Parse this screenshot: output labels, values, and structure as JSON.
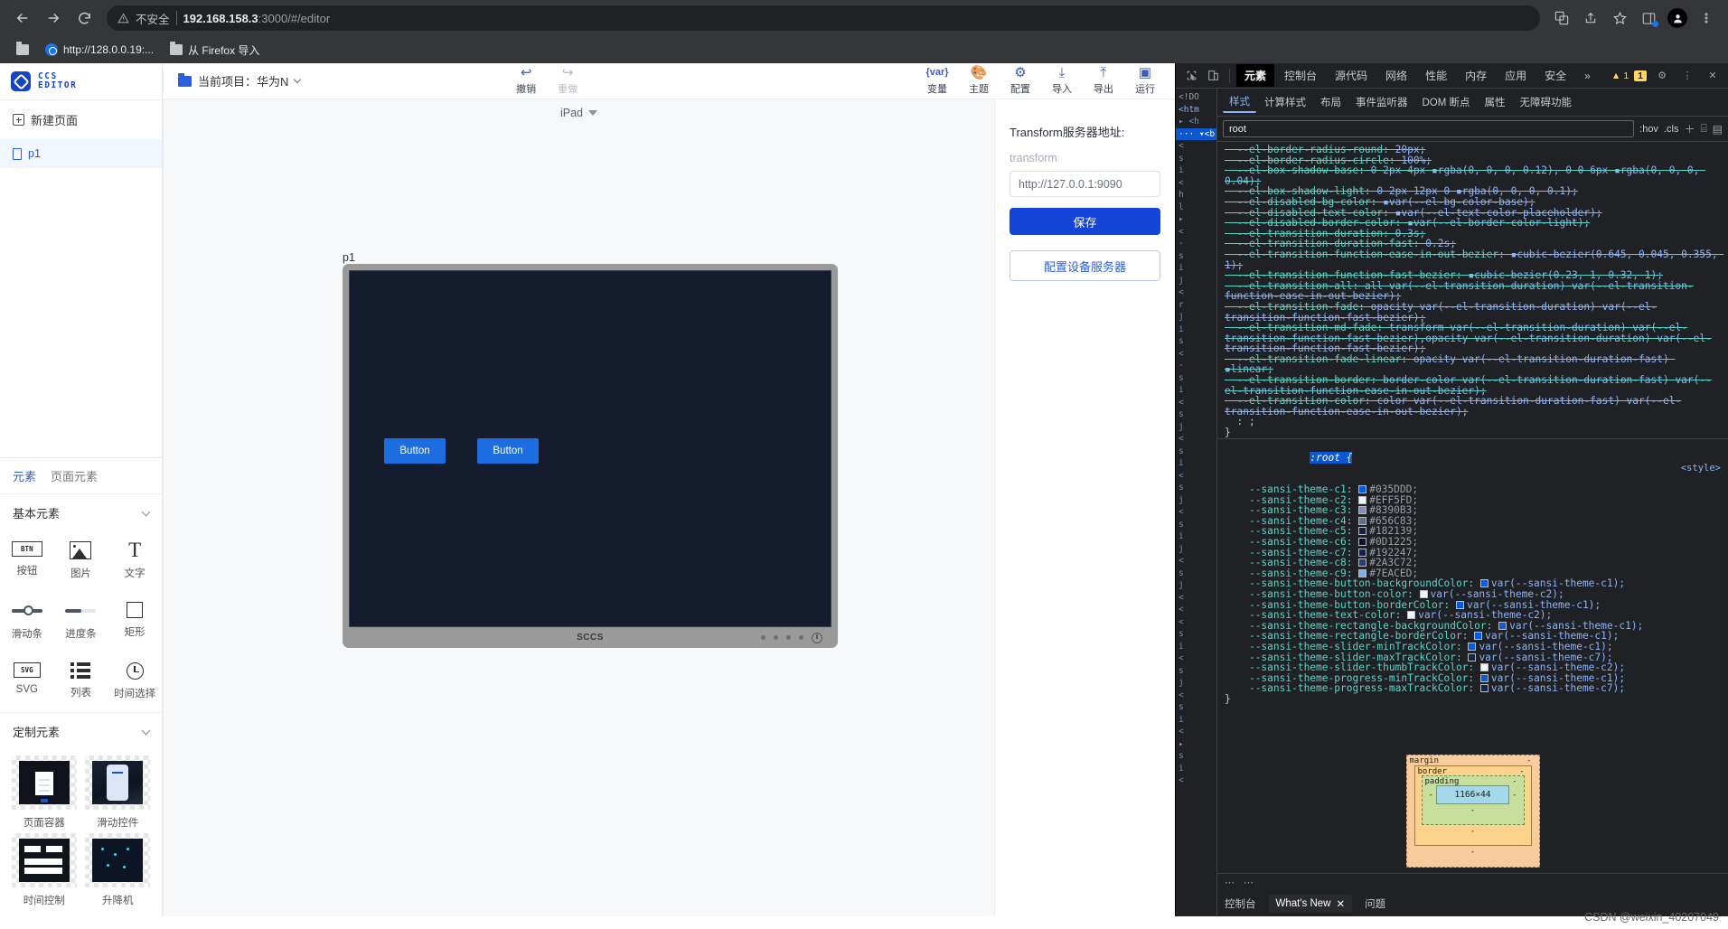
{
  "browser": {
    "security_label": "不安全",
    "url_host": "192.168.158.3",
    "url_path": ":3000/#/editor",
    "bookmarks": [
      {
        "label": "http://128.0.0.19:...",
        "icon": "globe-icon"
      },
      {
        "label": "从 Firefox 导入",
        "icon": "folder-icon"
      }
    ],
    "icons": [
      "translate-icon",
      "share-icon",
      "bookmark-star-icon",
      "side-panel-icon",
      "profile-avatar-icon",
      "more-menu-icon"
    ]
  },
  "app": {
    "logo_line1": "CCS",
    "logo_line2": "EDITOR",
    "project_label": "当前项目：华为N",
    "new_page": "新建页面",
    "pages": [
      {
        "name": "p1"
      }
    ],
    "toolbar": [
      {
        "label": "撤销",
        "icon": "undo-icon",
        "enabled": true
      },
      {
        "label": "重做",
        "icon": "redo-icon",
        "enabled": false
      },
      {
        "label": "变量",
        "icon": "var-icon",
        "enabled": true
      },
      {
        "label": "主题",
        "icon": "palette-icon",
        "enabled": true
      },
      {
        "label": "配置",
        "icon": "settings-icon",
        "enabled": true
      },
      {
        "label": "导入",
        "icon": "import-icon",
        "enabled": true
      },
      {
        "label": "导出",
        "icon": "export-icon",
        "enabled": true
      },
      {
        "label": "运行",
        "icon": "run-icon",
        "enabled": true
      }
    ]
  },
  "elements_panel": {
    "tabs": [
      {
        "label": "元素",
        "active": true
      },
      {
        "label": "页面元素",
        "active": false
      }
    ],
    "groups": [
      {
        "title": "基本元素",
        "items": [
          {
            "label": "按钮",
            "icon": "button-icon"
          },
          {
            "label": "图片",
            "icon": "image-icon"
          },
          {
            "label": "文字",
            "icon": "text-icon"
          },
          {
            "label": "滑动条",
            "icon": "slider-icon"
          },
          {
            "label": "进度条",
            "icon": "progress-icon"
          },
          {
            "label": "矩形",
            "icon": "rectangle-icon"
          },
          {
            "label": "SVG",
            "icon": "svg-icon"
          },
          {
            "label": "列表",
            "icon": "list-icon"
          },
          {
            "label": "时间选择",
            "icon": "time-picker-icon"
          }
        ]
      },
      {
        "title": "定制元素",
        "items": [
          {
            "label": "页面容器",
            "icon": "page-container-thumb"
          },
          {
            "label": "滑动控件",
            "icon": "slide-control-thumb"
          },
          {
            "label": "时间控制",
            "icon": "time-control-thumb"
          },
          {
            "label": "升降机",
            "icon": "elevator-thumb"
          }
        ]
      }
    ]
  },
  "canvas": {
    "device": "iPad",
    "page_name": "p1",
    "device_brand": "SCCS",
    "buttons": [
      {
        "label": "Button"
      },
      {
        "label": "Button"
      }
    ]
  },
  "properties": {
    "title": "Transform服务器地址:",
    "field_label": "transform",
    "input_placeholder": "http://127.0.0.1:9090",
    "input_value": "http://127.0.0.1:9090",
    "save_label": "保存",
    "config_label": "配置设备服务器"
  },
  "devtools": {
    "tabs": [
      {
        "label": "元素",
        "active": true
      },
      {
        "label": "控制台",
        "active": false
      },
      {
        "label": "源代码",
        "active": false
      },
      {
        "label": "网络",
        "active": false
      },
      {
        "label": "性能",
        "active": false
      },
      {
        "label": "内存",
        "active": false
      },
      {
        "label": "应用",
        "active": false
      },
      {
        "label": "安全",
        "active": false
      },
      {
        "label": "»",
        "active": false
      }
    ],
    "warning_count": "1",
    "issue_count": "1",
    "style_tabs": [
      {
        "label": "样式",
        "active": true
      },
      {
        "label": "计算样式",
        "active": false
      },
      {
        "label": "布局",
        "active": false
      },
      {
        "label": "事件监听器",
        "active": false
      },
      {
        "label": "DOM 断点",
        "active": false
      },
      {
        "label": "属性",
        "active": false
      },
      {
        "label": "无障碍功能",
        "active": false
      }
    ],
    "filter_value": "root",
    "filter_hov": ":hov",
    "filter_cls": ".cls",
    "overridden_rules": [
      "--el-border-radius-round: 20px;",
      "--el-border-radius-circle: 100%;",
      "--el-box-shadow-base: 0 2px 4px ▪rgba(0, 0, 0, 0.12), 0 0 6px ▪rgba(0, 0, 0, 0.04);",
      "--el-box-shadow-light: 0 2px 12px 0 ▪rgba(0, 0, 0, 0.1);",
      "--el-disabled-bg-color: ▪var(--el-bg-color-base);",
      "--el-disabled-text-color: ▪var(--el-text-color-placeholder);",
      "--el-disabled-border-color: ▪var(--el-border-color-light);",
      "--el-transition-duration: 0.3s;",
      "--el-transition-duration-fast: 0.2s;",
      "--el-transition-function-ease-in-out-bezier: ▪cubic-bezier(0.645, 0.045, 0.355, 1);",
      "--el-transition-function-fast-bezier: ▪cubic-bezier(0.23, 1, 0.32, 1);",
      "--el-transition-all: all var(--el-transition-duration) var(--el-transition-function-ease-in-out-bezier);",
      "--el-transition-fade: opacity var(--el-transition-duration) var(--el-transition-function-fast-bezier);",
      "--el-transition-md-fade: transform var(--el-transition-duration) var(--el-transition-function-fast-bezier),opacity var(--el-transition-duration) var(--el-transition-function-fast-bezier);",
      "--el-transition-fade-linear: opacity var(--el-transition-duration-fast) ▪linear;",
      "--el-transition-border: border-color var(--el-transition-duration-fast) var(--el-transition-function-ease-in-out-bezier);",
      "--el-transition-color: color var(--el-transition-duration-fast) var(--el-transition-function-ease-in-out-bezier);"
    ],
    "root_rule": {
      "selector": ":root {",
      "source": "<style>",
      "close": "}",
      "declarations": [
        {
          "prop": "--sansi-theme-c1",
          "value": "#035DDD",
          "swatch": "#035DDD"
        },
        {
          "prop": "--sansi-theme-c2",
          "value": "#EFF5FD",
          "swatch": "#EFF5FD"
        },
        {
          "prop": "--sansi-theme-c3",
          "value": "#8390B3",
          "swatch": "#8390B3"
        },
        {
          "prop": "--sansi-theme-c4",
          "value": "#656C83",
          "swatch": "#656C83"
        },
        {
          "prop": "--sansi-theme-c5",
          "value": "#182139",
          "swatch": "#182139"
        },
        {
          "prop": "--sansi-theme-c6",
          "value": "#0D1225",
          "swatch": "#0D1225"
        },
        {
          "prop": "--sansi-theme-c7",
          "value": "#192247",
          "swatch": "#192247"
        },
        {
          "prop": "--sansi-theme-c8",
          "value": "#2A3C72",
          "swatch": "#2A3C72"
        },
        {
          "prop": "--sansi-theme-c9",
          "value": "#7EACED",
          "swatch": "#7EACED"
        },
        {
          "prop": "--sansi-theme-button-backgroundColor",
          "value": "var(--sansi-theme-c1);",
          "swatch": "#035DDD",
          "isvar": true
        },
        {
          "prop": "--sansi-theme-button-color",
          "value": "var(--sansi-theme-c2);",
          "swatch": "#EFF5FD",
          "isvar": true
        },
        {
          "prop": "--sansi-theme-button-borderColor",
          "value": "var(--sansi-theme-c1);",
          "swatch": "#035DDD",
          "isvar": true
        },
        {
          "prop": "--sansi-theme-text-color",
          "value": "var(--sansi-theme-c2);",
          "swatch": "#EFF5FD",
          "isvar": true
        },
        {
          "prop": "--sansi-theme-rectangle-backgroundColor",
          "value": "var(--sansi-theme-c1);",
          "swatch": "#035DDD",
          "isvar": true
        },
        {
          "prop": "--sansi-theme-rectangle-borderColor",
          "value": "var(--sansi-theme-c1);",
          "swatch": "#035DDD",
          "isvar": true
        },
        {
          "prop": "--sansi-theme-slider-minTrackColor",
          "value": "var(--sansi-theme-c1);",
          "swatch": "#035DDD",
          "isvar": true
        },
        {
          "prop": "--sansi-theme-slider-maxTrackColor",
          "value": "var(--sansi-theme-c7);",
          "swatch": "#192247",
          "isvar": true
        },
        {
          "prop": "--sansi-theme-slider-thumbTrackColor",
          "value": "var(--sansi-theme-c2);",
          "swatch": "#EFF5FD",
          "isvar": true
        },
        {
          "prop": "--sansi-theme-progress-minTrackColor",
          "value": "var(--sansi-theme-c1);",
          "swatch": "#035DDD",
          "isvar": true
        },
        {
          "prop": "--sansi-theme-progress-maxTrackColor",
          "value": "var(--sansi-theme-c7);",
          "swatch": "#192247",
          "isvar": true
        }
      ]
    },
    "box_model": {
      "margin_label": "margin",
      "border_label": "border",
      "padding_label": "padding",
      "content": "1166×44",
      "dash": "-"
    },
    "footer": {
      "console_label": "控制台",
      "whats_new_label": "What's New",
      "issues_label": "问题"
    }
  },
  "watermark": "CSDN @weixin_40207049"
}
